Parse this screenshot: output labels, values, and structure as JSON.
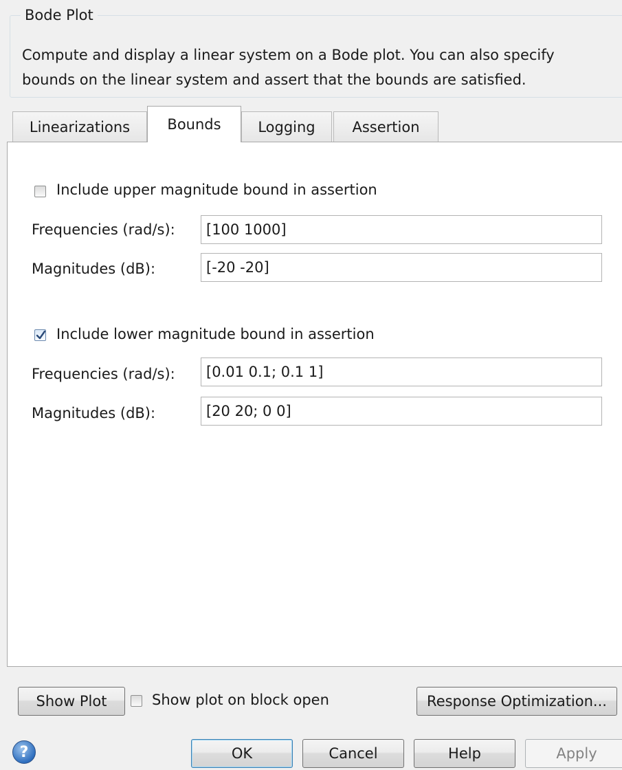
{
  "group": {
    "title": "Bode Plot",
    "description_line1": "Compute and display a linear system on a Bode plot. You can also specify",
    "description_line2": "bounds on the linear system and assert that the bounds are satisfied."
  },
  "tabs": [
    {
      "label": "Linearizations",
      "active": false
    },
    {
      "label": "Bounds",
      "active": true
    },
    {
      "label": "Logging",
      "active": false
    },
    {
      "label": "Assertion",
      "active": false
    }
  ],
  "upper_bound": {
    "checkbox_label": "Include upper magnitude bound in assertion",
    "checked": false,
    "freq_label": "Frequencies (rad/s):",
    "freq_value": "[100 1000]",
    "mag_label": "Magnitudes (dB):",
    "mag_value": "[-20 -20]"
  },
  "lower_bound": {
    "checkbox_label": "Include lower magnitude bound in assertion",
    "checked": true,
    "freq_label": "Frequencies (rad/s):",
    "freq_value": "[0.01 0.1; 0.1 1]",
    "mag_label": "Magnitudes (dB):",
    "mag_value": "[20 20; 0 0]"
  },
  "plot_row": {
    "show_plot_label": "Show Plot",
    "show_on_open_label": "Show plot on block open",
    "show_on_open_checked": false,
    "response_opt_label": "Response Optimization..."
  },
  "footer": {
    "help_glyph": "?",
    "ok_label": "OK",
    "cancel_label": "Cancel",
    "help_label": "Help",
    "apply_label": "Apply"
  },
  "icons": {
    "help": "question-circle-icon",
    "check": "checkmark-icon"
  },
  "colors": {
    "accent": "#3c7fb1",
    "panel_bg": "#ffffff",
    "window_bg": "#f0f0f0"
  }
}
